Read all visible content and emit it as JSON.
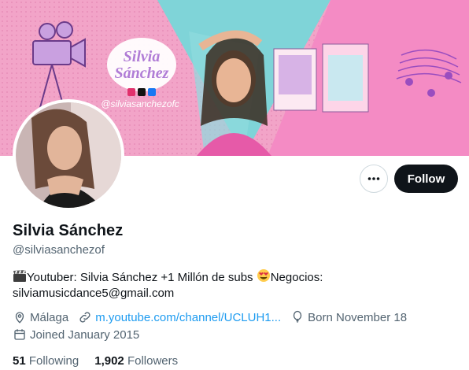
{
  "profile": {
    "banner_handle": "@silviasanchezofc",
    "banner_logo_line1": "Silvia",
    "banner_logo_line2": "Sánchez",
    "name": "Silvia Sánchez",
    "handle": "@silviasanchezof",
    "bio_part1": "Youtuber: Silvia Sánchez +1 Millón de subs ",
    "bio_part2": "Negocios: silviamusicdance5@gmail.com",
    "location": "Málaga",
    "website": "m.youtube.com/channel/UCLUH1...",
    "birthday": "Born November 18",
    "joined": "Joined January 2015",
    "following_count": "51",
    "following_label": "Following",
    "followers_count": "1,902",
    "followers_label": "Followers"
  },
  "actions": {
    "follow_label": "Follow"
  },
  "colors": {
    "accent": "#1d9bf0",
    "text": "#0f1419",
    "muted": "#536471",
    "banner_pink": "#f3a1c6",
    "banner_teal": "#7ed3d6"
  }
}
